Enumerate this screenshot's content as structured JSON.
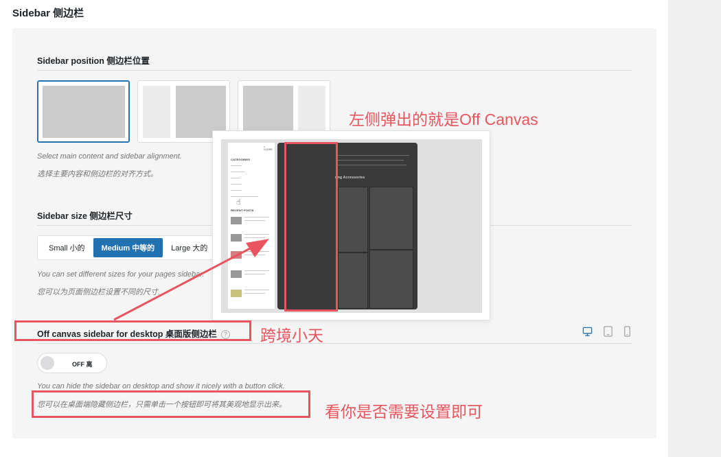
{
  "section_title": "Sidebar  侧边栏",
  "sidebar_position": {
    "label": "Sidebar position  侧边栏位置",
    "desc_en": "Select main content and sidebar alignment.",
    "desc_zh": "选择主要内容和侧边栏的对齐方式。",
    "options": [
      "no-sidebar",
      "left-sidebar",
      "right-sidebar"
    ],
    "selected": "no-sidebar"
  },
  "sidebar_size": {
    "label": "Sidebar size  侧边栏尺寸",
    "options": [
      "Small  小的",
      "Medium  中等的",
      "Large  大的"
    ],
    "selected": "Medium  中等的",
    "desc_en": "You can set different sizes for your pages sidebar.",
    "desc_zh": "您可以为页面侧边栏设置不同的尺寸."
  },
  "off_canvas": {
    "label": "Off canvas sidebar for desktop  桌面版侧边栏",
    "help": "?",
    "toggle_text": "OFF  离",
    "toggle_state": "off",
    "desc_en": "You can hide the sidebar on desktop and show it nicely with a button click.",
    "desc_zh": "您可以在桌面端隐藏侧边栏，只需单击一个按钮即可将其美观地显示出来。",
    "devices": [
      "desktop-icon",
      "tablet-icon",
      "mobile-icon"
    ],
    "active_device": "desktop-icon"
  },
  "annotations": {
    "popup_caption": "左侧弹出的就是Off Canvas",
    "label_caption": "跨境小天",
    "desc_caption": "看你是否需要设置即可",
    "color": "#e8555e"
  },
  "preview": {
    "close": "× CLOSE",
    "categories_head": "CATEGORIES",
    "categories": [
      "Decoration",
      "Home & Design",
      "Furniture",
      "Headliners",
      "Inspiration",
      "Interiors & architecture"
    ],
    "recent_head": "RECENT POSTS",
    "posts": [
      "A comparison for every sleeping",
      "Outdoor seating on the live living area",
      "Modular seating and loose furniture",
      "A half-pricked sofa made of wood and stone",
      "Natural tinge not outdoor seating"
    ],
    "main_heading": "ring Accessories"
  },
  "colors": {
    "accent": "#2271b1",
    "annotation": "#e8555e"
  }
}
